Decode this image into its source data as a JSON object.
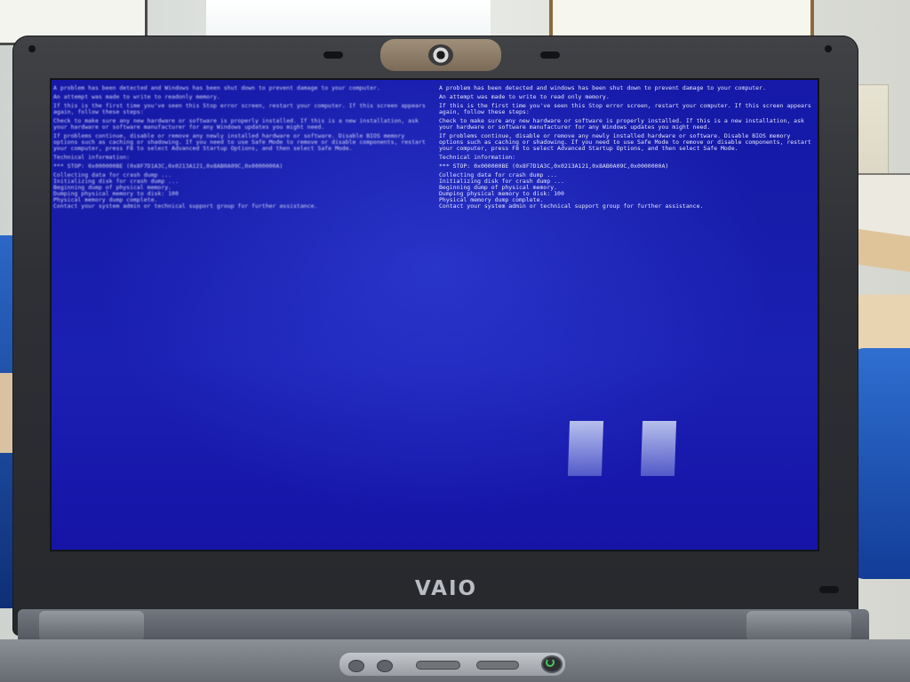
{
  "screen_text": {
    "left_column": [
      "A problem has been detected and Windows has been shut down to prevent damage to your computer.",
      "An attempt was made to write to readonly memory.",
      "If this is the first time you've seen this Stop error screen, restart your computer. If this screen appears again, follow these steps:",
      "Check to make sure any new hardware or software is properly installed. If this is a new installation, ask your hardware or software manufacturer for any Windows updates you might need.",
      "If problems continue, disable or remove any newly installed hardware or software. Disable BIOS memory options such as caching or shadowing. If you need to use Safe Mode to remove or disable components, restart your computer, press F8 to select Advanced Startup Options, and then select Safe Mode.",
      "Technical information:",
      "*** STOP: 0x000000BE (0x8F7D1A3C,0x0213A121,0x8AB0A09C,0x0000000A)",
      "Collecting data for crash dump ...\nInitializing disk for crash dump ...\nBeginning dump of physical memory.\nDumping physical memory to disk: 100\nPhysical memory dump complete.\nContact your system admin or technical support group for further assistance."
    ],
    "right_column": [
      "A problem has been detected and windows has been shut down to prevent damage to your computer.",
      "An attempt was made to write to read only memory.",
      "If this is the first time you've seen this Stop error screen, restart your computer. If this screen appears again, follow these steps:",
      "Check to make sure any new hardware or software is properly installed. If this is a new installation, ask your hardware or software manufacturer for any Windows updates you might need.",
      "If problems continue, disable or remove any newly installed hardware or software. Disable BIOS memory options such as caching or shadowing. If you need to use Safe Mode to remove or disable components, restart your computer, press F8 to select Advanced Startup Options, and then select Safe Mode.",
      "Technical information:",
      "*** STOP: 0x000000BE (0x8F7D1A3C,0x0213A121,0x8AB0A09C,0x0000000A)",
      "Collecting data for crash dump ...\nInitializing disk for crash dump ...\nBeginning dump of physical memory.\nDumping physical memory to disk: 100\nPhysical memory dump complete.\nContact your system admin or technical support group for further assistance."
    ]
  },
  "brand": {
    "logo_text": "VAIO"
  },
  "colors": {
    "screen_blue": "#1619a8",
    "screen_text": "#eef0ff",
    "bezel": "#2e3035",
    "power_led": "#49c95b"
  },
  "icons": {
    "power": "power-icon",
    "webcam": "webcam-icon"
  }
}
